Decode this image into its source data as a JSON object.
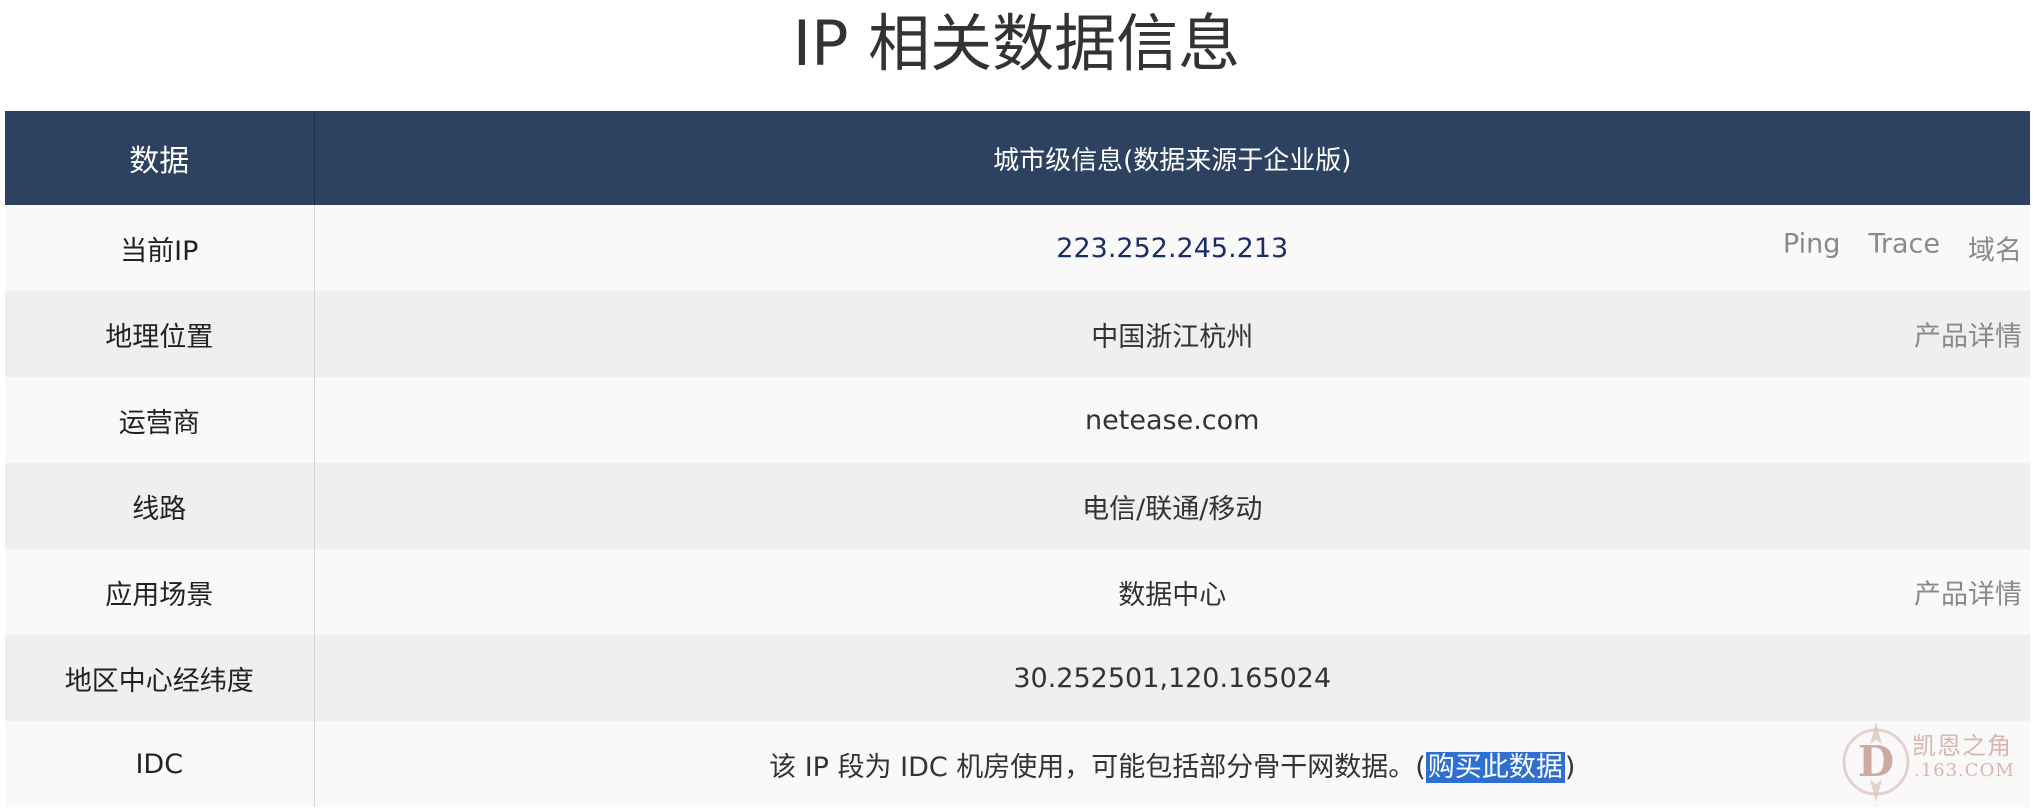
{
  "page": {
    "title": "IP 相关数据信息"
  },
  "table": {
    "headers": [
      "数据",
      "城市级信息(数据来源于企业版)"
    ],
    "rows": [
      {
        "label": "当前IP",
        "value": "223.252.245.213",
        "links": [
          "Ping",
          "Trace",
          "域名"
        ]
      },
      {
        "label": "地理位置",
        "value": "中国浙江杭州",
        "links": [
          "产品详情"
        ]
      },
      {
        "label": "运营商",
        "value": "netease.com",
        "links": []
      },
      {
        "label": "线路",
        "value": "电信/联通/移动",
        "links": []
      },
      {
        "label": "应用场景",
        "value": "数据中心",
        "links": [
          "产品详情"
        ]
      },
      {
        "label": "地区中心经纬度",
        "value": "30.252501,120.165024",
        "links": []
      },
      {
        "label": "IDC",
        "value_prefix": "该 IP 段为 IDC 机房使用，可能包括部分骨干网数据。(",
        "buy_link": "购买此数据",
        "value_suffix": ")"
      }
    ]
  },
  "watermark": {
    "line1": "凯恩之角",
    "line2": ".163.COM",
    "logo_letter": "D"
  },
  "colors": {
    "header_bg": "#2c4260",
    "row_odd": "#f9f9f9",
    "row_even": "#efefef",
    "ip_color": "#1a2e66",
    "link_grey": "#8a8a8a",
    "buy_highlight": "#2f6fd0"
  }
}
